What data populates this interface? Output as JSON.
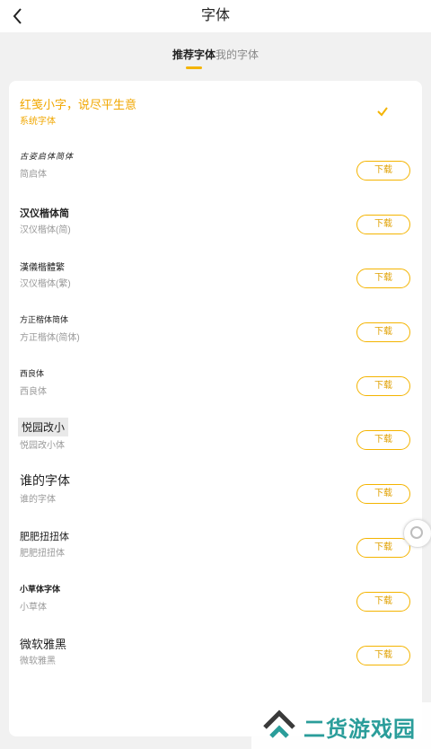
{
  "header": {
    "title": "字体",
    "back_icon": "chevron-left-icon"
  },
  "tabs": [
    {
      "label": "推荐字体",
      "active": true
    },
    {
      "label": "我的字体",
      "active": false
    }
  ],
  "fonts": [
    {
      "preview": "红笺小字，说尽平生意",
      "name": "系统字体",
      "selected": true
    },
    {
      "preview": "古姿启体简体",
      "name": "简启体",
      "action": "下载"
    },
    {
      "preview": "汉仪楷体简",
      "name": "汉仪楷体(简)",
      "action": "下载"
    },
    {
      "preview": "漢儀楷體繁",
      "name": "汉仪楷体(繁)",
      "action": "下载"
    },
    {
      "preview": "方正楷体简体",
      "name": "方正楷体(简体)",
      "action": "下载"
    },
    {
      "preview": "西良体",
      "name": "西良体",
      "action": "下载"
    },
    {
      "preview": "悦园改小",
      "name": "悦园改小体",
      "action": "下载"
    },
    {
      "preview": "谁的字体",
      "name": "谁的字体",
      "action": "下载"
    },
    {
      "preview": "肥肥扭扭体",
      "name": "肥肥扭扭体",
      "action": "下载"
    },
    {
      "preview": "小草体字体",
      "name": "小草体",
      "action": "下载"
    },
    {
      "preview": "微软雅黑",
      "name": "微软雅黑",
      "action": "下载"
    }
  ],
  "watermark": {
    "text": "二货游戏园"
  },
  "colors": {
    "accent": "#f4b400",
    "selected_text": "#f1a700",
    "watermark": "#2a9d9a"
  }
}
